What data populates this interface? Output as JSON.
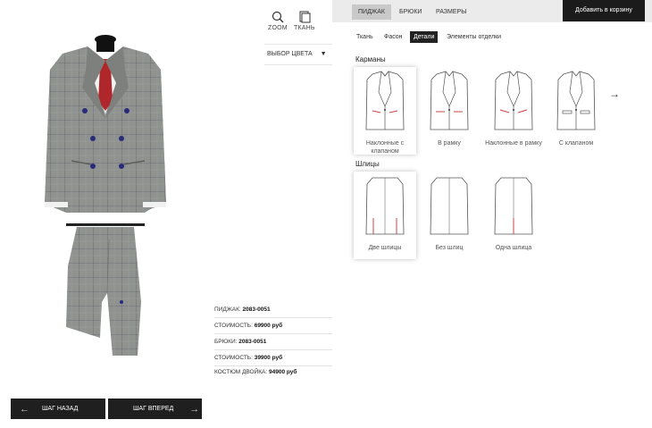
{
  "tools": {
    "zoom_label": "ZOOM",
    "fabric_label": "ТКАНЬ",
    "color_select_label": "ВЫБОР ЦВЕТА"
  },
  "summary": [
    {
      "label": "ПИДЖАК:",
      "value": "2083-0051"
    },
    {
      "label": "СТОИМОСТЬ:",
      "value": "69900 руб"
    },
    {
      "label": "БРЮКИ:",
      "value": "2083-0051"
    },
    {
      "label": "СТОИМОСТЬ:",
      "value": "39900 руб"
    },
    {
      "label": "КОСТЮМ ДВОЙКА:",
      "value": "94900 руб"
    }
  ],
  "nav": {
    "back_label": "ШАГ НАЗАД",
    "forward_label": "ШАГ ВПЕРЕД"
  },
  "top_tabs": [
    "ПИДЖАК",
    "БРЮКИ",
    "РАЗМЕРЫ"
  ],
  "cart_label": "Добавить в корзину",
  "sub_tabs": [
    "Ткань",
    "Фасон",
    "Детали",
    "Элементы отделки"
  ],
  "pockets": {
    "title": "Карманы",
    "options": [
      "Наклонные с клапаном",
      "В рамку",
      "Наклонные в рамку",
      "С клапаном"
    ]
  },
  "vents": {
    "title": "Шлицы",
    "options": [
      "Две шлицы",
      "Без шлиц",
      "Одна шлица"
    ]
  },
  "colors": {
    "dark": "#1f1f1f",
    "fabric": "#8e918e",
    "tie": "#b0272b",
    "pocket_accent": "#d94a5a"
  }
}
